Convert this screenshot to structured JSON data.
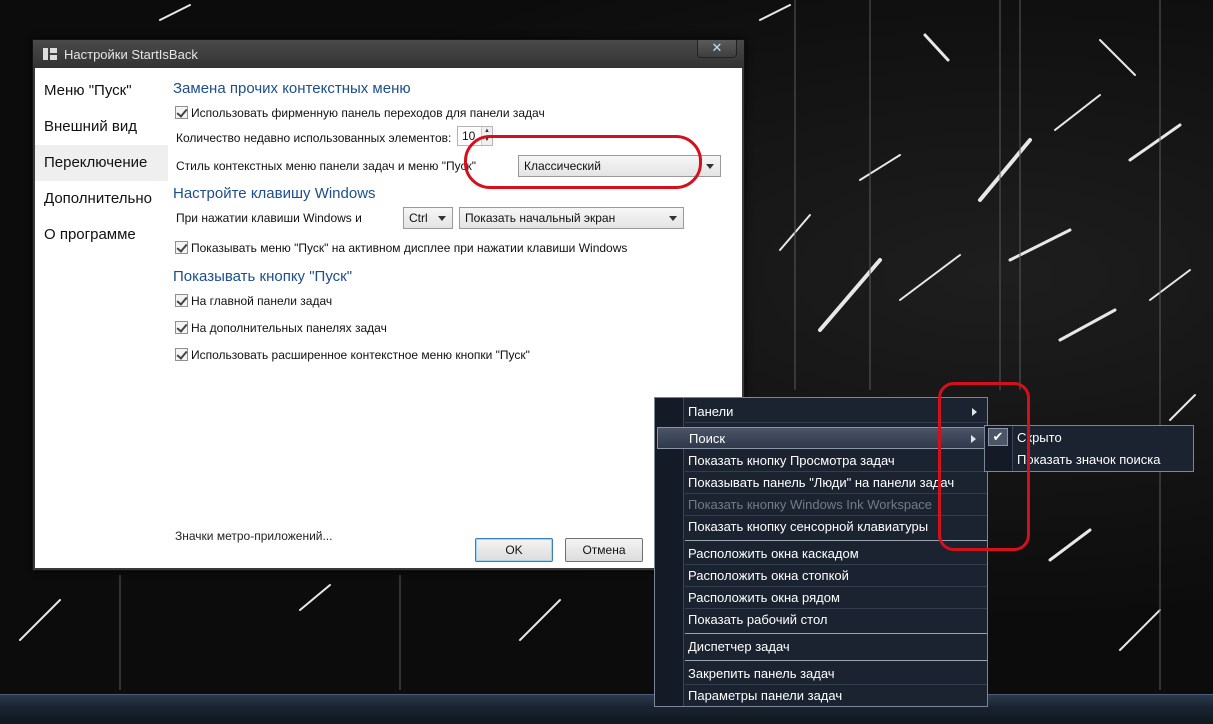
{
  "window": {
    "title": "Настройки StartIsBack",
    "close_glyph": "✕"
  },
  "sidebar": {
    "items": [
      {
        "label": "Меню \"Пуск\"",
        "active": false
      },
      {
        "label": "Внешний вид",
        "active": false
      },
      {
        "label": "Переключение",
        "active": true
      },
      {
        "label": "Дополнительно",
        "active": false
      },
      {
        "label": "О программе",
        "active": false
      }
    ]
  },
  "content": {
    "section1_title": "Замена прочих контекстных меню",
    "use_jumplist_label": "Использовать фирменную панель переходов для панели задач",
    "use_jumplist_checked": true,
    "recent_items_label": "Количество недавно использованных элементов:",
    "recent_items_value": "10",
    "menu_style_label": "Стиль контекстных меню панели задач и меню \"Пуск\"",
    "menu_style_value": "Классический",
    "section2_title": "Настройте клавишу Windows",
    "winkey_label": "При нажатии клавиши Windows и",
    "winkey_modifier": "Ctrl",
    "winkey_action": "Показать начальный экран",
    "active_display_label": "Показывать меню \"Пуск\" на активном дисплее при нажатии клавиши Windows",
    "active_display_checked": true,
    "section3_title": "Показывать кнопку \"Пуск\"",
    "main_taskbar_label": "На главной панели задач",
    "main_taskbar_checked": true,
    "extra_taskbars_label": "На дополнительных панелях задач",
    "extra_taskbars_checked": true,
    "extended_menu_label": "Использовать расширенное контекстное меню кнопки \"Пуск\"",
    "extended_menu_checked": true,
    "metro_icons_link": "Значки метро-приложений..."
  },
  "buttons": {
    "ok": "OK",
    "cancel": "Отмена"
  },
  "context_menu": {
    "items": [
      {
        "label": "Панели",
        "submenu": true
      },
      {
        "label": "Поиск",
        "submenu": true,
        "highlighted": true
      },
      {
        "label": "Показать кнопку Просмотра задач"
      },
      {
        "label": "Показывать панель \"Люди\" на панели задач"
      },
      {
        "label": "Показать кнопку Windows Ink Workspace",
        "disabled": true
      },
      {
        "label": "Показать кнопку сенсорной клавиатуры"
      },
      {
        "label": "Расположить окна каскадом"
      },
      {
        "label": "Расположить окна стопкой"
      },
      {
        "label": "Расположить окна рядом"
      },
      {
        "label": "Показать рабочий стол"
      },
      {
        "label": "Диспетчер задач"
      },
      {
        "label": "Закрепить панель задач"
      },
      {
        "label": "Параметры панели задач"
      }
    ]
  },
  "search_submenu": {
    "items": [
      {
        "label": "Скрыто",
        "checked": true
      },
      {
        "label": "Показать значок поиска",
        "checked": false
      }
    ],
    "check_glyph": "✔"
  },
  "colors": {
    "annotation": "#d4101c",
    "section_title": "#1c4f8c",
    "menu_bg": "#1b2330"
  }
}
